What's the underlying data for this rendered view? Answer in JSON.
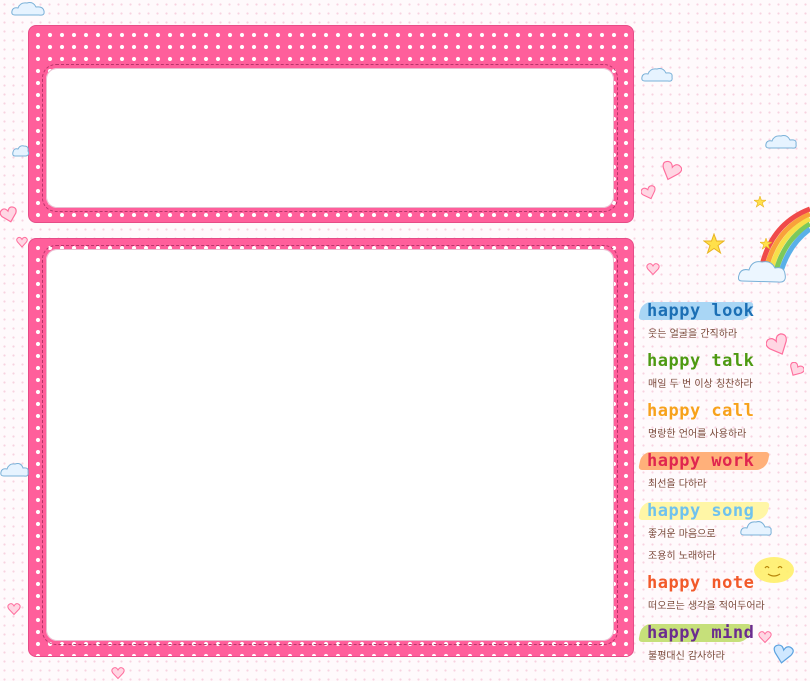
{
  "menu": {
    "items": [
      {
        "title": "happy look",
        "subtitle": "웃는 얼굴을 간직하라",
        "color": "#1b6fb5",
        "brush": "#a9d6f5"
      },
      {
        "title": "happy talk",
        "subtitle": "매일 두 번 이상 칭찬하라",
        "color": "#4e9a12",
        "brush": ""
      },
      {
        "title": "happy call",
        "subtitle": "명랑한 언어를 사용하라",
        "color": "#f7a21b",
        "brush": ""
      },
      {
        "title": "happy work",
        "subtitle": "최선을 다하라",
        "color": "#e0264f",
        "brush": "#ffb07a"
      },
      {
        "title": "happy song",
        "subtitle": "좋겨운 마음으로",
        "color": "#6fc2ee",
        "brush": "#fff6a6"
      },
      {
        "title": "",
        "subtitle": "조용히 노래하라",
        "color": "#7a4a3a",
        "brush": ""
      },
      {
        "title": "happy note",
        "subtitle": "떠오르는 생각을 적어두어라",
        "color": "#f2592a",
        "brush": ""
      },
      {
        "title": "happy mind",
        "subtitle": "불평대신 감사하라",
        "color": "#6b2c8f",
        "brush": "#c6e07a"
      }
    ]
  },
  "colors": {
    "panel_pink": "#ff5f9b",
    "panel_border": "#e64c87",
    "background": "#fffafc"
  },
  "icons": [
    "cloud-icon",
    "heart-icon",
    "star-icon",
    "rainbow-icon",
    "sun-icon"
  ]
}
